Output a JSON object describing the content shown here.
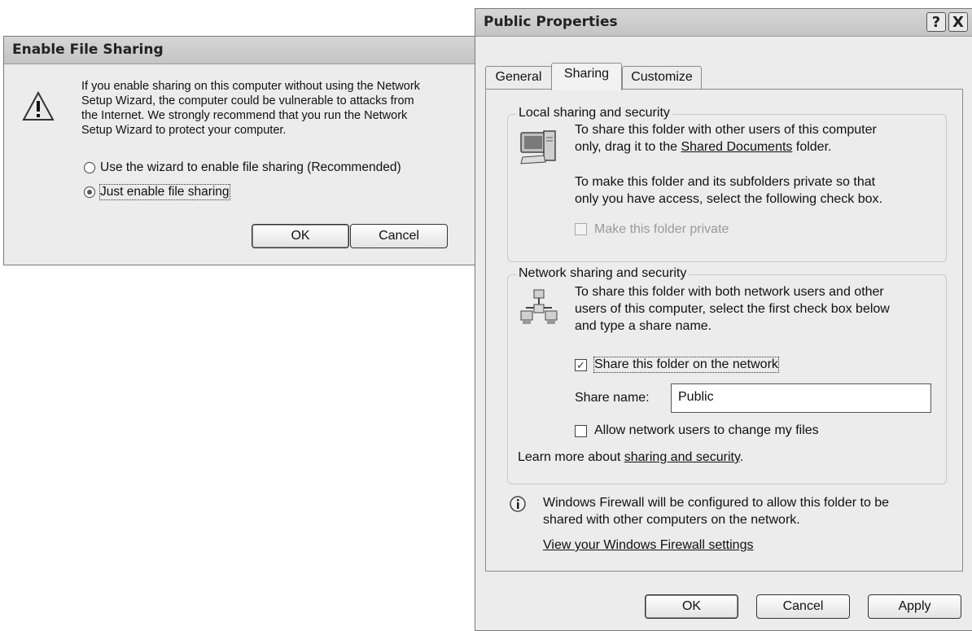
{
  "enable_dialog": {
    "title": "Enable File Sharing",
    "icon": "warning-icon",
    "message_lines": [
      "If you enable sharing on this computer without using the Network",
      "Setup Wizard, the computer could be vulnerable to attacks from",
      "the Internet. We strongly recommend that you run the Network",
      "Setup Wizard to protect your computer."
    ],
    "option_wizard": "Use the wizard to enable file sharing (Recommended)",
    "option_just_enable": "Just enable file sharing",
    "selected_option": "option_just_enable",
    "ok_label": "OK",
    "cancel_label": "Cancel"
  },
  "properties_dialog": {
    "title": "Public Properties",
    "help_glyph": "?",
    "close_glyph": "X",
    "tabs": [
      {
        "label": "General"
      },
      {
        "label": "Sharing",
        "active": true
      },
      {
        "label": "Customize"
      }
    ],
    "local_group": {
      "title": "Local sharing and security",
      "icon": "computer-icon",
      "text1_before": "To share this folder with other users of this computer",
      "text1_line2_before": "only, drag it to the ",
      "shared_documents_link": "Shared Documents",
      "text1_line2_after": " folder.",
      "text2_line1": "To make this folder and its subfolders private so that",
      "text2_line2": "only you have access, select the following check box.",
      "private_checkbox_label": "Make this folder private",
      "private_checked": false,
      "private_disabled": true
    },
    "network_group": {
      "title": "Network sharing and security",
      "icon": "network-icon",
      "text_lines": [
        "To share this folder with both network users and other",
        "users of this computer, select the first check box below",
        "and type a share name."
      ],
      "share_checkbox_label": "Share this folder on the network",
      "share_checked": true,
      "share_name_label": "Share name:",
      "share_name_value": "Public",
      "allow_checkbox_label": "Allow network users to change my files",
      "allow_checked": false,
      "learn_more_text": "Learn more about ",
      "learn_more_link": "sharing and security",
      "learn_more_after": "."
    },
    "firewall": {
      "icon": "info-icon",
      "line1": "Windows Firewall will be configured to allow this folder to be",
      "line2": "shared with other computers on the network.",
      "settings_link": "View your Windows Firewall settings"
    },
    "ok_label": "OK",
    "cancel_label": "Cancel",
    "apply_label": "Apply"
  }
}
